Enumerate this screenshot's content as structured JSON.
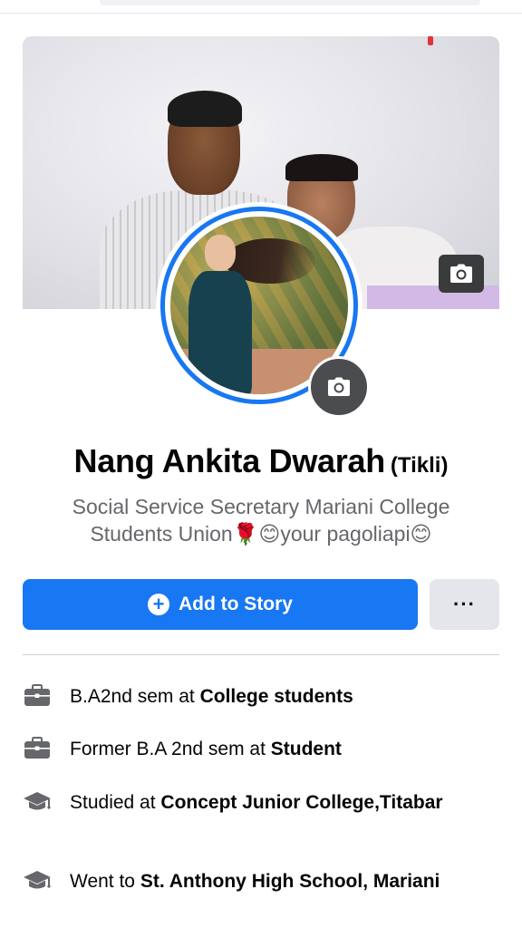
{
  "profile": {
    "name": "Nang Ankita Dwarah",
    "nickname": "(Tikli)",
    "bio": "Social Service Secretary Mariani College Students Union🌹😊your pagoliapi😊"
  },
  "actions": {
    "add_story_label": "Add to Story",
    "more_label": "···"
  },
  "info": [
    {
      "icon": "briefcase-icon",
      "prefix": "B.A2nd sem at ",
      "bold": "College students"
    },
    {
      "icon": "briefcase-icon",
      "prefix": "Former B.A 2nd sem at ",
      "bold": "Student"
    },
    {
      "icon": "graduation-cap-icon",
      "prefix": "Studied at ",
      "bold": "Concept Junior College,Titabar"
    },
    {
      "icon": "graduation-cap-icon",
      "prefix": "Went to ",
      "bold": "St. Anthony High School, Mariani"
    }
  ],
  "colors": {
    "primary": "#1877f2",
    "secondary_button": "#e4e6eb",
    "muted_text": "#65676b"
  }
}
